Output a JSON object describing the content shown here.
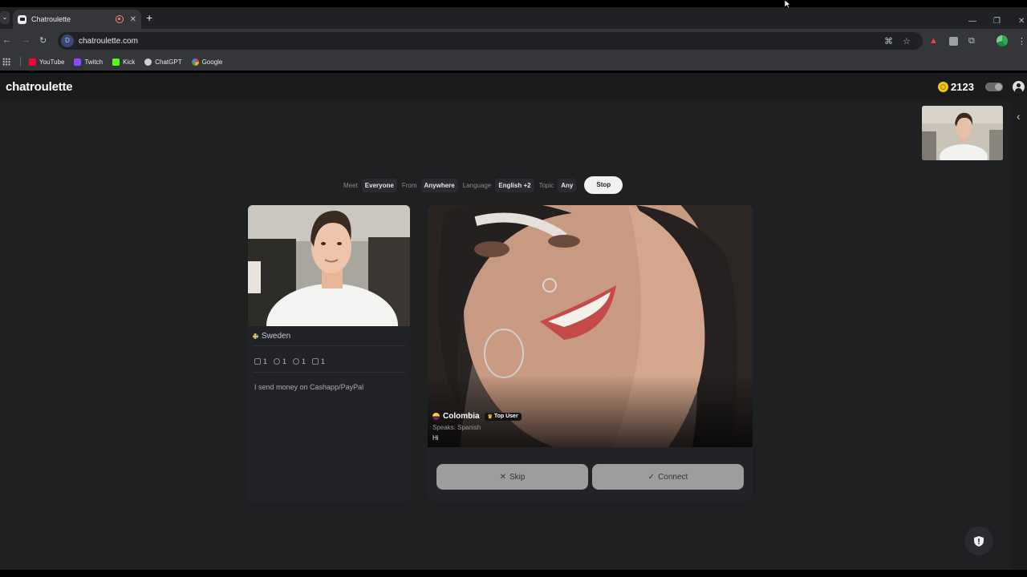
{
  "browser": {
    "tab_title": "Chatroulette",
    "new_tab": "+",
    "address": "chatroulette.com",
    "site_icon": "D",
    "bookmarks": [
      {
        "label": "YouTube",
        "color": "#ff0033"
      },
      {
        "label": "Twitch",
        "color": "#9146ff"
      },
      {
        "label": "Kick",
        "color": "#53fc18"
      },
      {
        "label": "ChatGPT",
        "color": "#cfcfcf"
      },
      {
        "label": "Google",
        "color": "#4285f4"
      }
    ]
  },
  "header": {
    "logo": "chatroulette",
    "coins": "2123"
  },
  "filters": {
    "meet_label": "Meet",
    "meet_value": "Everyone",
    "from_label": "From",
    "from_value": "Anywhere",
    "language_label": "Language",
    "language_value": "English +2",
    "topic_label": "Topic",
    "topic_value": "Any",
    "stop_label": "Stop"
  },
  "profile": {
    "country": "Sweden",
    "stats": [
      "1",
      "1",
      "1",
      "1"
    ],
    "bio": "I send money on Cashapp/PayPal"
  },
  "stranger": {
    "country": "Colombia",
    "badge": "Top User",
    "speaks": "Speaks: Spanish",
    "message": "Hi"
  },
  "actions": {
    "skip_label": "Skip",
    "skip_icon": "✕",
    "connect_label": "Connect",
    "connect_icon": "✓"
  },
  "colors": {
    "background": "#1f2022",
    "accent_coin": "#f5c518",
    "button": "#9d9d9d"
  }
}
